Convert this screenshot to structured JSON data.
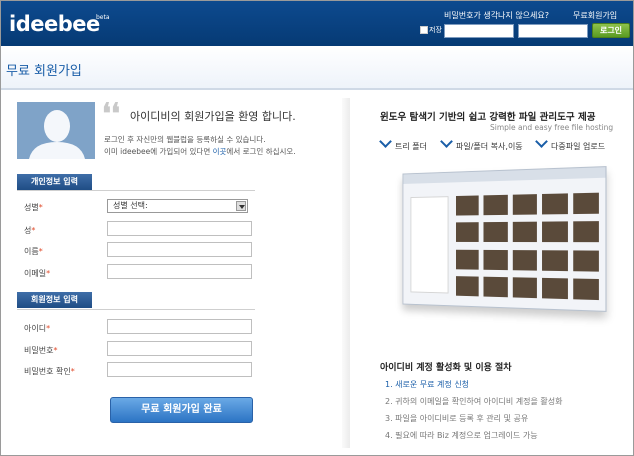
{
  "header": {
    "logo": "ideebee",
    "beta": "beta",
    "forgot_password": "비밀번호가 생각나지 않으세요?",
    "free_signup": "무료회원가입",
    "save_label": "저장",
    "login_button": "로그인"
  },
  "page": {
    "title": "무료 회원가입"
  },
  "intro": {
    "welcome": "아이디비의 회원가입을 환영 합니다.",
    "line1": "로그인 후 자신만의 웹블럽을 등록하실 수 있습니다.",
    "line2_pre": "이미 ideebee에 가입되어 있다면 ",
    "line2_link": "이곳",
    "line2_post": "에서 로그인 하십시오."
  },
  "personal": {
    "header": "개인정보 입력",
    "gender_label": "성별",
    "gender_select": "성별 선택:",
    "lastname_label": "성",
    "firstname_label": "이름",
    "email_label": "이메일"
  },
  "account": {
    "header": "회원정보 입력",
    "id_label": "아이디",
    "password_label": "비밀번호",
    "password_confirm_label": "비밀번호 확인"
  },
  "required_mark": "*",
  "submit_label": "무료 회원가입 완료",
  "promo": {
    "title": "윈도우 탐색기 기반의 쉽고 강력한 파일 관리도구 제공",
    "subtitle": "Simple and easy free file hosting",
    "features": [
      "트리 폴더",
      "파일/폴더 복사,이동",
      "다중파일 업로드"
    ]
  },
  "steps": {
    "title": "아이디비 계정 활성화 및 이용 절차",
    "items": [
      "1. 새로운 무료 계정 신청",
      "2. 귀하의 이메일을 확인하여 아이디비 계정을 활성화",
      "3. 파일을 아이디비로 등록 후 관리 및 공유",
      "4. 필요에 따라 Biz 계정으로 업그레이드 가능"
    ]
  }
}
